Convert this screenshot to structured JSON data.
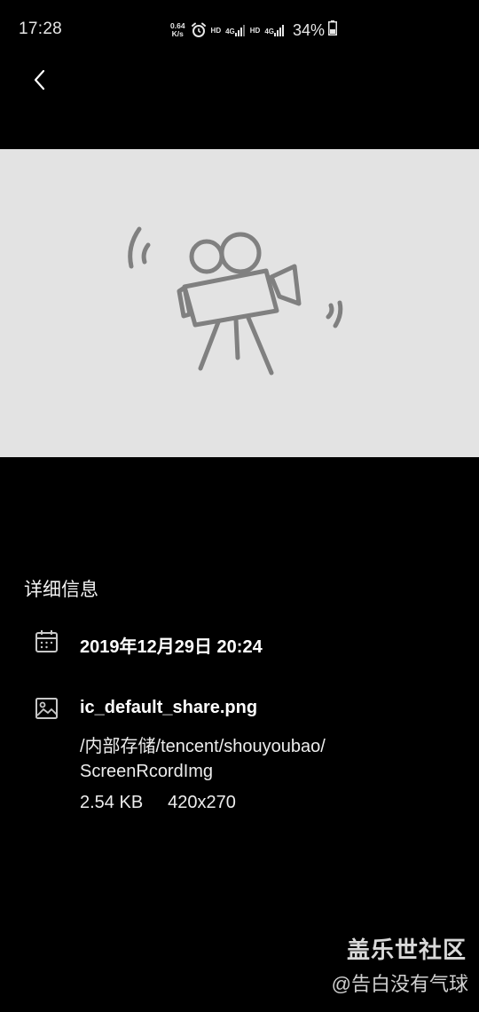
{
  "status_bar": {
    "time": "17:28",
    "net_speed_value": "0.64",
    "net_speed_unit": "K/s",
    "alarm_icon": "alarm-clock-icon",
    "hd_label": "HD",
    "network_label": "4G",
    "battery_percent": "34%"
  },
  "header": {
    "back_icon": "chevron-left-icon"
  },
  "preview": {
    "image_icon": "video-camera-on-tripod-illustration",
    "background_color": "#e3e3e3",
    "illustration_color": "#808080"
  },
  "details": {
    "section_title": "详细信息",
    "date_icon": "calendar-icon",
    "date": "2019年12月29日 20:24",
    "file_icon": "image-icon",
    "file_name": "ic_default_share.png",
    "path_line1": "/内部存储/tencent/shouyoubao/",
    "path_line2": "ScreenRcordImg",
    "file_size": "2.54 KB",
    "dimensions": "420x270"
  },
  "watermark": {
    "title": "盖乐世社区",
    "user": "@告白没有气球"
  }
}
